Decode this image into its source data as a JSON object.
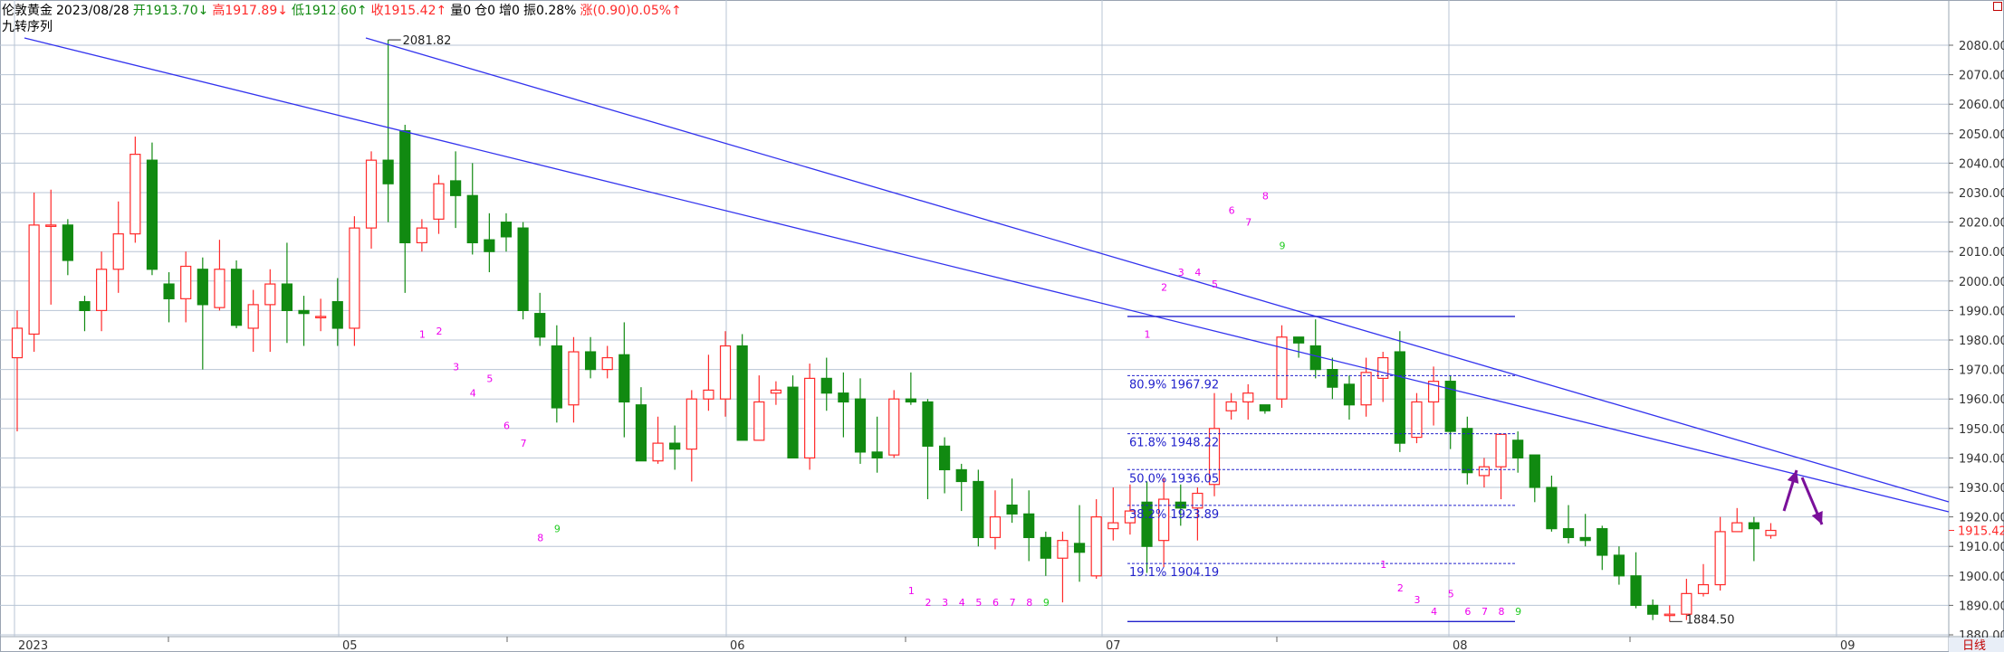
{
  "header": {
    "instrument": "伦敦黄金",
    "date": "2023/08/28",
    "open_label": "开",
    "open_value": "1913.70↓",
    "high_label": "高",
    "high_value": "1917.89↓",
    "low_label": "低",
    "low_value": "1912.60↑",
    "close_label": "收",
    "close_value": "1915.42↑",
    "volume": "量0",
    "open_interest": "仓0",
    "increase": "增0",
    "amplitude": "振0.28%",
    "change": "涨(0.90)0.05%↑"
  },
  "subtitle": "九转序列",
  "colors": {
    "up": "#ff2a2a",
    "down": "#118a11",
    "trendline": "#3333ee",
    "fib": "#2222cc",
    "seq_up": "#ee00ee",
    "seq_nine": "#22cc22",
    "arrow": "#7a109a",
    "grid": "#b8c4d4"
  },
  "chart_data": {
    "type": "candlestick",
    "timeframe_label": "日线",
    "y_ticks": [
      "1880.00",
      "1890.00",
      "1900.00",
      "1910.00",
      "1920.00",
      "1930.00",
      "1940.00",
      "1950.00",
      "1960.00",
      "1970.00",
      "1980.00",
      "1990.00",
      "2000.00",
      "2010.00",
      "2020.00",
      "2030.00",
      "2040.00",
      "2050.00",
      "2060.00",
      "2070.00",
      "2080.00"
    ],
    "ylim": [
      1877,
      2087
    ],
    "x_labels": [
      "2023",
      "05",
      "06",
      "07",
      "08",
      "09"
    ],
    "last_price": "1915.42",
    "high_annotation": "2081.82",
    "low_annotation": "1884.50",
    "fib_levels": [
      {
        "label": "80.9%",
        "value": 1967.92,
        "text": "1967.92"
      },
      {
        "label": "61.8%",
        "value": 1948.22,
        "text": "1948.22"
      },
      {
        "label": "50.0%",
        "value": 1936.05,
        "text": "1936.05"
      },
      {
        "label": "38.2%",
        "value": 1923.89,
        "text": "1923.89"
      },
      {
        "label": "19.1%",
        "value": 1904.19,
        "text": "1904.19"
      }
    ],
    "candles": [
      [
        1974,
        1984,
        1949,
        1990
      ],
      [
        1982,
        2019,
        1976,
        2030
      ],
      [
        2019,
        2019,
        1992,
        2031
      ],
      [
        2019,
        2007,
        2002,
        2021
      ],
      [
        1993,
        1990,
        1983,
        1995
      ],
      [
        1990,
        2004,
        1983,
        2010
      ],
      [
        2004,
        2016,
        1996,
        2027
      ],
      [
        2016,
        2043,
        2013,
        2049
      ],
      [
        2041,
        2004,
        2002,
        2047
      ],
      [
        1999,
        1994,
        1986,
        2003
      ],
      [
        1994,
        2005,
        1986,
        2010
      ],
      [
        2004,
        1992,
        1970,
        2008
      ],
      [
        1991,
        2004,
        1990,
        2014
      ],
      [
        2004,
        1985,
        1984,
        2007
      ],
      [
        1984,
        1992,
        1976,
        1997
      ],
      [
        1992,
        1999,
        1976,
        2004
      ],
      [
        1999,
        1990,
        1979,
        2013
      ],
      [
        1990,
        1989,
        1978,
        1995
      ],
      [
        1988,
        1988,
        1983,
        1994
      ],
      [
        1993,
        1984,
        1978,
        2001
      ],
      [
        1984,
        2018,
        1978,
        2022
      ],
      [
        2018,
        2041,
        2011,
        2044
      ],
      [
        2041,
        2033,
        2020,
        2081.82
      ],
      [
        2051,
        2013,
        1996,
        2053
      ],
      [
        2013,
        2018,
        2010,
        2021
      ],
      [
        2021,
        2033,
        2016,
        2036
      ],
      [
        2034,
        2029,
        2018,
        2044
      ],
      [
        2029,
        2013,
        2009,
        2040
      ],
      [
        2014,
        2010,
        2003,
        2023
      ],
      [
        2020,
        2015,
        2010,
        2023
      ],
      [
        2018,
        1990,
        1987,
        2020
      ],
      [
        1989,
        1981,
        1978,
        1996
      ],
      [
        1978,
        1957,
        1952,
        1985
      ],
      [
        1958,
        1976,
        1952,
        1981
      ],
      [
        1976,
        1970,
        1967,
        1981
      ],
      [
        1970,
        1974,
        1967,
        1978
      ],
      [
        1975,
        1959,
        1947,
        1986
      ],
      [
        1958,
        1939,
        1939,
        1964
      ],
      [
        1939,
        1945,
        1938,
        1954
      ],
      [
        1945,
        1943,
        1936,
        1951
      ],
      [
        1943,
        1960,
        1932,
        1963
      ],
      [
        1960,
        1963,
        1956,
        1975
      ],
      [
        1960,
        1978,
        1954,
        1983
      ],
      [
        1978,
        1946,
        1946,
        1982
      ],
      [
        1946,
        1959,
        1946,
        1968
      ],
      [
        1962,
        1963,
        1958,
        1966
      ],
      [
        1964,
        1940,
        1940,
        1968
      ],
      [
        1940,
        1967,
        1936,
        1972
      ],
      [
        1967,
        1962,
        1956,
        1974
      ],
      [
        1962,
        1959,
        1947,
        1969
      ],
      [
        1960,
        1942,
        1938,
        1967
      ],
      [
        1942,
        1940,
        1935,
        1954
      ],
      [
        1941,
        1960,
        1940,
        1963
      ],
      [
        1960,
        1959,
        1958,
        1969
      ],
      [
        1959,
        1944,
        1926,
        1960
      ],
      [
        1944,
        1936,
        1928,
        1947
      ],
      [
        1936,
        1932,
        1922,
        1938
      ],
      [
        1932,
        1913,
        1910,
        1936
      ],
      [
        1913,
        1920,
        1909,
        1929
      ],
      [
        1924,
        1921,
        1918,
        1933
      ],
      [
        1921,
        1913,
        1905,
        1929
      ],
      [
        1913,
        1906,
        1900,
        1915
      ],
      [
        1906,
        1912,
        1891,
        1915
      ],
      [
        1911,
        1908,
        1898,
        1924
      ],
      [
        1900,
        1920,
        1899,
        1926
      ],
      [
        1916,
        1918,
        1912,
        1930
      ],
      [
        1918,
        1922,
        1914,
        1931
      ],
      [
        1925,
        1910,
        1901,
        1932
      ],
      [
        1912,
        1926,
        1903,
        1933
      ],
      [
        1925,
        1923,
        1917,
        1931
      ],
      [
        1923,
        1928,
        1912,
        1930
      ],
      [
        1931,
        1950,
        1927,
        1962
      ],
      [
        1956,
        1959,
        1953,
        1962
      ],
      [
        1959,
        1962,
        1953,
        1965
      ],
      [
        1958,
        1956,
        1955,
        1958
      ],
      [
        1960,
        1981,
        1957,
        1985
      ],
      [
        1981,
        1979,
        1974,
        1981
      ],
      [
        1978,
        1970,
        1967,
        1987
      ],
      [
        1970,
        1964,
        1960,
        1974
      ],
      [
        1965,
        1958,
        1953,
        1968
      ],
      [
        1958,
        1969,
        1954,
        1974
      ],
      [
        1967,
        1974,
        1959,
        1976
      ],
      [
        1976,
        1945,
        1942,
        1983
      ],
      [
        1947,
        1959,
        1945,
        1962
      ],
      [
        1959,
        1966,
        1951,
        1971
      ],
      [
        1966,
        1949,
        1943,
        1968
      ],
      [
        1950,
        1935,
        1931,
        1954
      ],
      [
        1934,
        1937,
        1930,
        1940
      ],
      [
        1937,
        1948,
        1926,
        1948
      ],
      [
        1946,
        1940,
        1935,
        1949
      ],
      [
        1941,
        1930,
        1925,
        1940
      ],
      [
        1930,
        1916,
        1915,
        1934
      ],
      [
        1916,
        1913,
        1911,
        1924
      ],
      [
        1913,
        1912,
        1910,
        1921
      ],
      [
        1916,
        1907,
        1902,
        1917
      ],
      [
        1907,
        1900,
        1897,
        1910
      ],
      [
        1900,
        1890,
        1889,
        1908
      ],
      [
        1890,
        1887,
        1885,
        1892
      ],
      [
        1887,
        1887,
        1884.5,
        1890
      ],
      [
        1887,
        1894,
        1885,
        1899
      ],
      [
        1894,
        1897,
        1893,
        1904
      ],
      [
        1897,
        1915,
        1895,
        1920
      ],
      [
        1915,
        1918,
        1915,
        1923
      ],
      [
        1918,
        1916,
        1905,
        1920
      ],
      [
        1913.7,
        1915.42,
        1912.6,
        1917.89
      ]
    ],
    "td_sequence": [
      {
        "label": "1",
        "bar": 24,
        "value": 1982,
        "color": "up"
      },
      {
        "label": "2",
        "bar": 25,
        "value": 1983,
        "color": "up"
      },
      {
        "label": "3",
        "bar": 26,
        "value": 1971,
        "color": "up"
      },
      {
        "label": "4",
        "bar": 27,
        "value": 1962,
        "color": "up"
      },
      {
        "label": "5",
        "bar": 28,
        "value": 1967,
        "color": "up"
      },
      {
        "label": "6",
        "bar": 29,
        "value": 1951,
        "color": "up"
      },
      {
        "label": "7",
        "bar": 30,
        "value": 1945,
        "color": "up"
      },
      {
        "label": "8",
        "bar": 31,
        "value": 1913,
        "color": "up"
      },
      {
        "label": "9",
        "bar": 32,
        "value": 1916,
        "color": "nine"
      },
      {
        "label": "1",
        "bar": 53,
        "value": 1895,
        "color": "up"
      },
      {
        "label": "2",
        "bar": 54,
        "value": 1891,
        "color": "up"
      },
      {
        "label": "3",
        "bar": 55,
        "value": 1891,
        "color": "up"
      },
      {
        "label": "4",
        "bar": 56,
        "value": 1891,
        "color": "up"
      },
      {
        "label": "5",
        "bar": 57,
        "value": 1891,
        "color": "up"
      },
      {
        "label": "6",
        "bar": 58,
        "value": 1891,
        "color": "up"
      },
      {
        "label": "7",
        "bar": 59,
        "value": 1891,
        "color": "up"
      },
      {
        "label": "8",
        "bar": 60,
        "value": 1891,
        "color": "up"
      },
      {
        "label": "9",
        "bar": 61,
        "value": 1891,
        "color": "nine"
      },
      {
        "label": "1",
        "bar": 67,
        "value": 1982,
        "color": "up"
      },
      {
        "label": "2",
        "bar": 68,
        "value": 1998,
        "color": "up"
      },
      {
        "label": "3",
        "bar": 69,
        "value": 2003,
        "color": "up"
      },
      {
        "label": "4",
        "bar": 70,
        "value": 2003,
        "color": "up"
      },
      {
        "label": "5",
        "bar": 71,
        "value": 1999,
        "color": "up"
      },
      {
        "label": "6",
        "bar": 72,
        "value": 2024,
        "color": "up"
      },
      {
        "label": "7",
        "bar": 73,
        "value": 2020,
        "color": "up"
      },
      {
        "label": "8",
        "bar": 74,
        "value": 2029,
        "color": "up"
      },
      {
        "label": "9",
        "bar": 75,
        "value": 2012,
        "color": "nine"
      },
      {
        "label": "1",
        "bar": 81,
        "value": 1904,
        "color": "up"
      },
      {
        "label": "2",
        "bar": 82,
        "value": 1896,
        "color": "up"
      },
      {
        "label": "3",
        "bar": 83,
        "value": 1892,
        "color": "up"
      },
      {
        "label": "4",
        "bar": 84,
        "value": 1888,
        "color": "up"
      },
      {
        "label": "5",
        "bar": 85,
        "value": 1894,
        "color": "up"
      },
      {
        "label": "6",
        "bar": 86,
        "value": 1888,
        "color": "up"
      },
      {
        "label": "7",
        "bar": 87,
        "value": 1888,
        "color": "up"
      },
      {
        "label": "8",
        "bar": 88,
        "value": 1888,
        "color": "up"
      },
      {
        "label": "9",
        "bar": 89,
        "value": 1888,
        "color": "nine"
      }
    ]
  }
}
